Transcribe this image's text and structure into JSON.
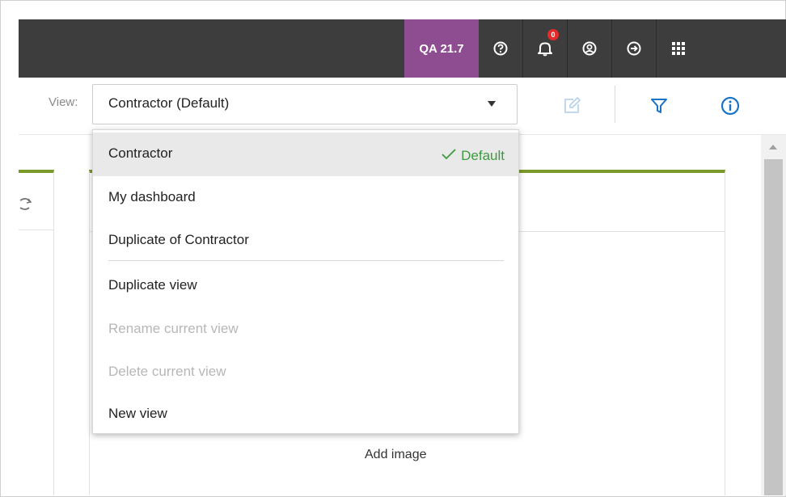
{
  "topbar": {
    "env_label": "QA 21.7",
    "notification_count": "0",
    "icons": [
      "help-icon",
      "bell-icon",
      "user-icon",
      "logout-icon",
      "apps-grid-icon"
    ]
  },
  "toolbar": {
    "view_label": "View:",
    "selected_view": "Contractor (Default)",
    "icons": [
      "edit-icon",
      "filter-icon",
      "info-icon"
    ]
  },
  "dropdown": {
    "views": [
      {
        "label": "Contractor",
        "tag": "Default",
        "selected": true
      },
      {
        "label": "My dashboard"
      },
      {
        "label": "Duplicate of Contractor"
      }
    ],
    "actions": [
      {
        "label": "Duplicate view",
        "enabled": true
      },
      {
        "label": "Rename current view",
        "enabled": false
      },
      {
        "label": "Delete current view",
        "enabled": false
      },
      {
        "label": "New view",
        "enabled": true
      }
    ]
  },
  "content": {
    "add_image_label": "Add image"
  },
  "colors": {
    "topbar_bg": "#3d3d3d",
    "env_badge": "#8e4d91",
    "accent_green": "#7a9a2a",
    "default_green": "#3e9a3e",
    "brand_blue": "#1a73c8"
  }
}
